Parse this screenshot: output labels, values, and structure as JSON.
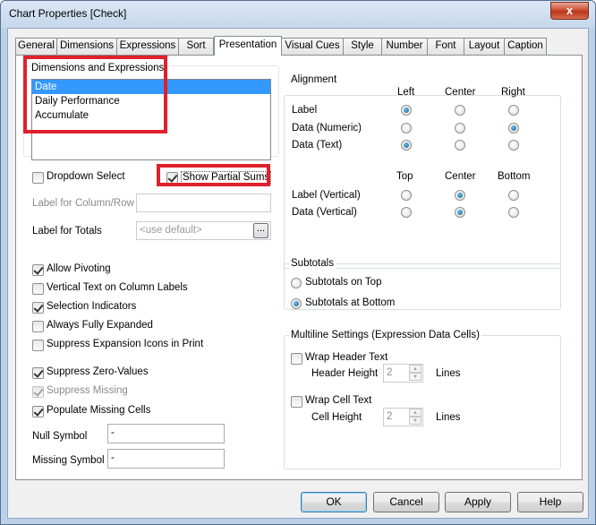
{
  "window": {
    "title": "Chart Properties [Check]",
    "close_glyph": "x"
  },
  "tabs": [
    "General",
    "Dimensions",
    "Expressions",
    "Sort",
    "Presentation",
    "Visual Cues",
    "Style",
    "Number",
    "Font",
    "Layout",
    "Caption"
  ],
  "active_tab": "Presentation",
  "dimensions": {
    "title": "Dimensions and Expressions",
    "items": [
      "Date",
      "Daily Performance",
      "Accumulate"
    ],
    "selected": "Date"
  },
  "dropdown_select": {
    "label": "Dropdown Select",
    "checked": false
  },
  "show_partial_sums": {
    "label": "Show Partial Sums",
    "checked": true
  },
  "label_column_row": {
    "label": "Label for Column/Row",
    "value": ""
  },
  "label_totals": {
    "label": "Label for Totals",
    "placeholder": "<use default>",
    "browse": "..."
  },
  "options": [
    {
      "label": "Allow Pivoting",
      "checked": true
    },
    {
      "label": "Vertical Text on Column Labels",
      "checked": false
    },
    {
      "label": "Selection Indicators",
      "checked": true
    },
    {
      "label": "Always Fully Expanded",
      "checked": false
    },
    {
      "label": "Suppress Expansion Icons in Print",
      "checked": false
    },
    {
      "label": "Suppress Zero-Values",
      "checked": true
    },
    {
      "label": "Suppress Missing",
      "checked": true,
      "disabled": true
    },
    {
      "label": "Populate Missing Cells",
      "checked": true
    }
  ],
  "null_symbol": {
    "label": "Null Symbol",
    "value": "-"
  },
  "missing_symbol": {
    "label": "Missing Symbol",
    "value": "-"
  },
  "alignment": {
    "title": "Alignment",
    "cols1": [
      "Left",
      "Center",
      "Right"
    ],
    "rows1": [
      {
        "label": "Label",
        "selected": "Left"
      },
      {
        "label": "Data (Numeric)",
        "selected": "Right"
      },
      {
        "label": "Data (Text)",
        "selected": "Left"
      }
    ],
    "cols2": [
      "Top",
      "Center",
      "Bottom"
    ],
    "rows2": [
      {
        "label": "Label (Vertical)",
        "selected": "Center"
      },
      {
        "label": "Data (Vertical)",
        "selected": "Center"
      }
    ]
  },
  "subtotals": {
    "title": "Subtotals",
    "options": [
      "Subtotals on Top",
      "Subtotals at Bottom"
    ],
    "selected": "Subtotals at Bottom"
  },
  "multiline": {
    "title": "Multiline Settings (Expression Data Cells)",
    "wrap_header": {
      "label": "Wrap Header Text",
      "checked": false
    },
    "header_height": {
      "label": "Header Height",
      "value": "2",
      "unit": "Lines"
    },
    "wrap_cell": {
      "label": "Wrap Cell Text",
      "checked": false
    },
    "cell_height": {
      "label": "Cell Height",
      "value": "2",
      "unit": "Lines"
    }
  },
  "buttons": {
    "ok": "OK",
    "cancel": "Cancel",
    "apply": "Apply",
    "help": "Help"
  },
  "colors": {
    "highlight_red": "#e0202c",
    "selection_blue": "#3399ff"
  }
}
